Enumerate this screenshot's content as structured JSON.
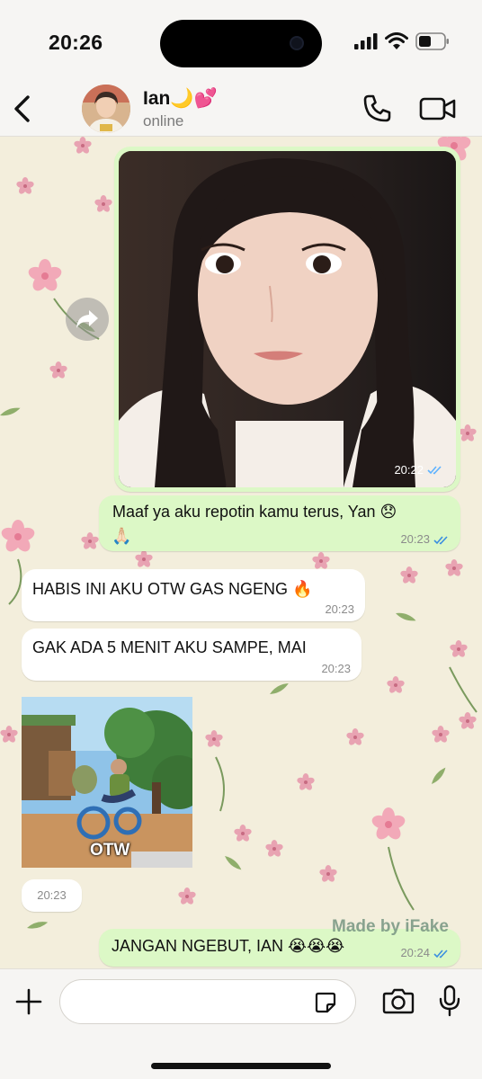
{
  "status_bar": {
    "time": "20:26",
    "battery_percent": 50
  },
  "header": {
    "contact_name": "Ian🌙💕",
    "contact_status": "online",
    "icons": [
      "back-chevron-icon",
      "phone-icon",
      "video-camera-icon"
    ]
  },
  "messages": [
    {
      "type": "image",
      "direction": "outgoing",
      "time": "20:22",
      "status": "read"
    },
    {
      "type": "text",
      "direction": "outgoing",
      "line1": "Maaf ya aku repotin kamu terus, Yan 😞",
      "line2": "🙏🏻",
      "time": "20:23",
      "status": "read"
    },
    {
      "type": "text",
      "direction": "incoming",
      "text": "HABIS INI AKU OTW GAS NGENG 🔥",
      "time": "20:23"
    },
    {
      "type": "text",
      "direction": "incoming",
      "text": "GAK ADA 5 MENIT AKU SAMPE, MAI",
      "time": "20:23"
    },
    {
      "type": "sticker",
      "direction": "incoming",
      "caption": "OTW",
      "time": "20:23"
    },
    {
      "type": "text",
      "direction": "outgoing",
      "text": "JANGAN NGEBUT, IAN 😭😭😭",
      "time": "20:24",
      "status": "read"
    }
  ],
  "watermark": "Made by iFake",
  "input": {
    "value": "",
    "placeholder": ""
  },
  "colors": {
    "outgoing_bubble": "#dcf8c6",
    "incoming_bubble": "#ffffff",
    "read_ticks": "#3b8fe0",
    "wallpaper": "#f3eedc"
  }
}
